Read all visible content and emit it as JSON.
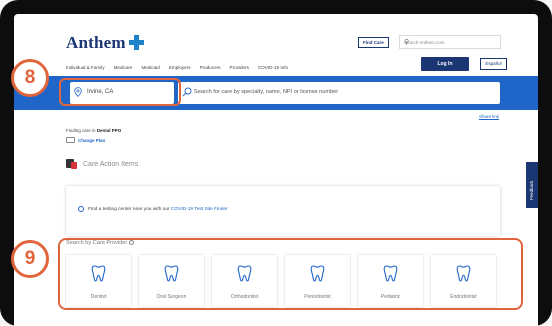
{
  "header": {
    "logo_text": "Anthem",
    "find_care_label": "Find Care",
    "search_placeholder": "Search Anthem.com",
    "nav_items": [
      "Individual & Family",
      "Medicare",
      "Medicaid",
      "Employers",
      "Producers",
      "Providers",
      "COVID-19 Info"
    ],
    "login_label": "Log In",
    "espanol_label": "Español"
  },
  "search_bar": {
    "location_value": "Irvine, CA",
    "care_placeholder": "Search for care by specialty, name, NPI or license number"
  },
  "annotations": {
    "badge_8": "8",
    "badge_9": "9"
  },
  "share_link": "Share link",
  "plan": {
    "finding_care_label": "Finding care in",
    "plan_name": "Dental PPO",
    "change_plan_label": "Change Plan"
  },
  "care_action": {
    "title": "Care Action Items",
    "message": "Find a testing center near you with our",
    "link": "COVID-19 Test Site Finder"
  },
  "feedback_label": "Feedback",
  "providers": {
    "title": "Search by Care Provider",
    "items": [
      "Dentist",
      "Oral Surgeon",
      "Orthodontist",
      "Periodontist",
      "Pediatric",
      "Endodontist"
    ]
  },
  "colors": {
    "brand_blue": "#1a3673",
    "band_blue": "#1f66c8",
    "highlight_orange": "#e0653d"
  }
}
